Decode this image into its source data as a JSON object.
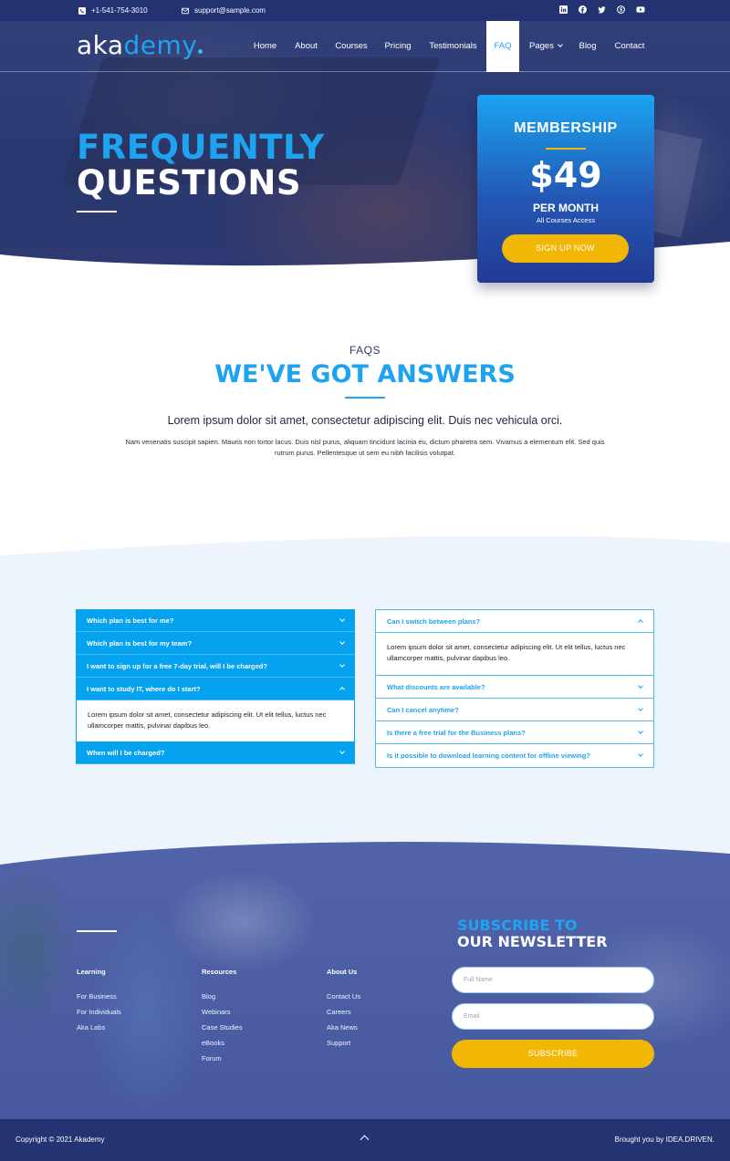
{
  "topbar": {
    "phone": "+1-541-754-3010",
    "email": "support@sample.com",
    "social_icons": [
      "linkedin-icon",
      "facebook-icon",
      "twitter-icon",
      "skype-icon",
      "youtube-icon"
    ]
  },
  "brand": {
    "logo_part1": "aka",
    "logo_part2": "demy"
  },
  "nav": {
    "items": [
      "Home",
      "About",
      "Courses",
      "Pricing",
      "Testimonials",
      "FAQ",
      "Pages",
      "Blog",
      "Contact"
    ],
    "active": "FAQ"
  },
  "hero": {
    "title_line1": "FREQUENTLY",
    "title_line2": "QUESTIONS"
  },
  "membership": {
    "title": "MEMBERSHIP",
    "price": "$49",
    "period": "PER MONTH",
    "note": "All Courses Access",
    "cta": "SIGN UP NOW"
  },
  "intro": {
    "eyebrow": "FAQS",
    "title": "WE'VE GOT ANSWERS",
    "lead": "Lorem ipsum dolor sit amet, consectetur adipiscing elit. Duis nec vehicula orci.",
    "body": "Nam venenatis suscipit sapien. Mauris non tortor lacus. Duis nisl purus, aliquam tincidunt lacinia eu, dictum pharetra sem. Vivamus a elementum elit. Sed quis rutrum purus. Pellentesque ut sem eu nibh facilisis volutpat."
  },
  "faq_left": {
    "q1": "Which plan is best for me?",
    "q2": "Which plan is best for my team?",
    "q3": "I want to sign up for a free 7-day trial, will I be charged?",
    "q4": "I want to study IT, where do I start?",
    "a4": "Lorem ipsum dolor sit amet, consectetur adipiscing elit. Ut elit tellus, luctus nec ullamcorper mattis, pulvinar dapibus leo.",
    "q5": "When will I be charged?"
  },
  "faq_right": {
    "q1": "Can I switch between plans?",
    "a1": "Lorem ipsum dolor sit amet, consectetur adipiscing elit. Ut elit tellus, luctus nec ullamcorper mattis, pulvinar dapibus leo.",
    "q2": "What discounts are available?",
    "q3": "Can I cancel anytime?",
    "q4": "Is there a free trial for the Business plans?",
    "q5": "Is it possible to download learning content for offline viewing?"
  },
  "footer": {
    "learning": {
      "heading": "Learning",
      "links": [
        "For Business",
        "For Individuals",
        "Aka Labs"
      ]
    },
    "resources": {
      "heading": "Resources",
      "links": [
        "Blog",
        "Webinars",
        "Case Studies",
        "eBooks",
        "Forum"
      ]
    },
    "about": {
      "heading": "About Us",
      "links": [
        "Contact Us",
        "Careers",
        "Aka News",
        "Support"
      ]
    },
    "newsletter": {
      "title_line1": "SUBSCRIBE TO",
      "title_line2": "OUR NEWSLETTER",
      "name_placeholder": "Full Name",
      "email_placeholder": "Email",
      "button": "SUBSCRIBE"
    }
  },
  "copyright": {
    "left": "Copyright © 2021 Akademy",
    "right": "Brought you by IDEA.DRIVEN."
  },
  "colors": {
    "brand_blue": "#1ea3f0",
    "navy": "#233372",
    "accent_yellow": "#f2b705"
  }
}
